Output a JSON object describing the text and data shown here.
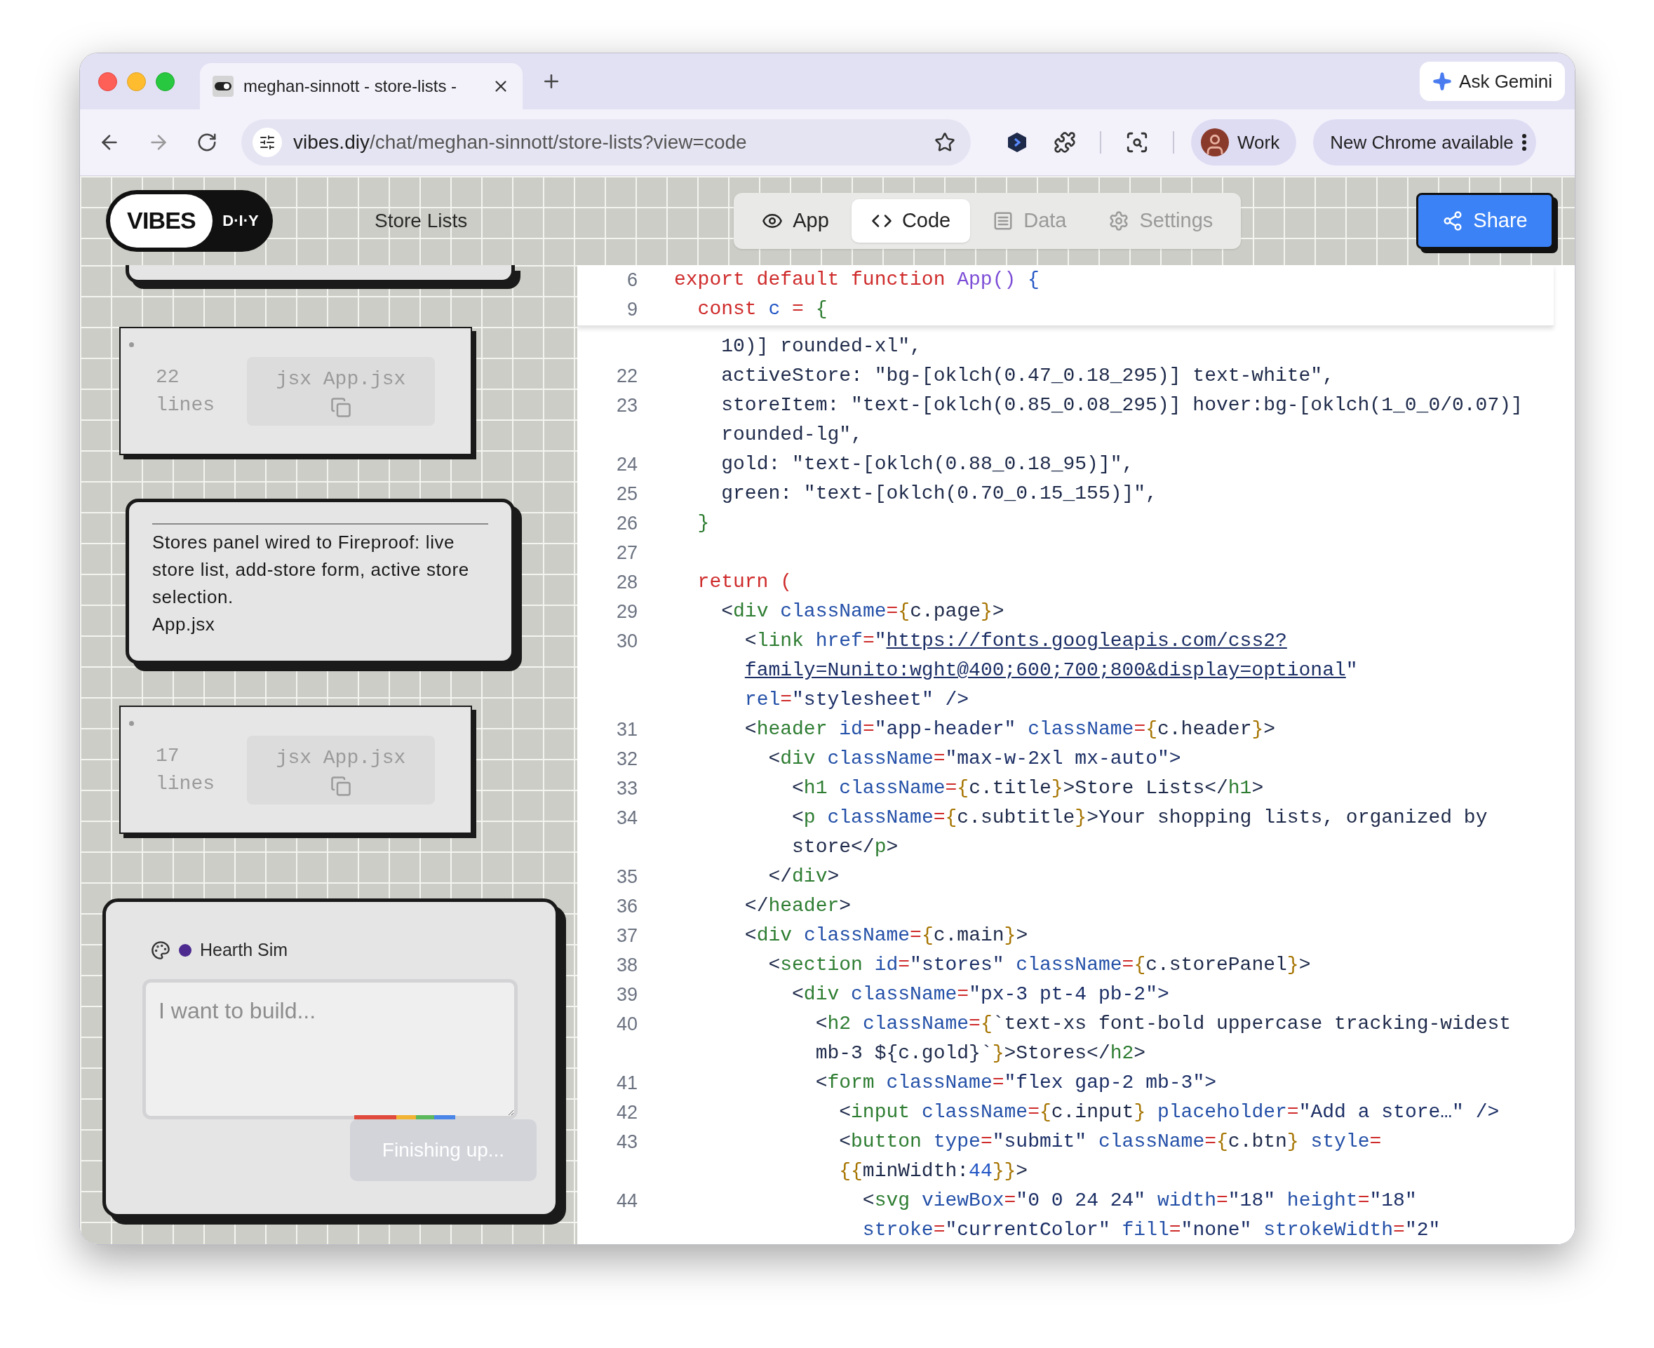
{
  "browser": {
    "tab": {
      "title": "meghan-sinnott - store-lists -"
    },
    "ask_gemini": "Ask Gemini",
    "url": {
      "host": "vibes.diy",
      "path": "/chat/meghan-sinnott/store-lists?view=code"
    },
    "profile": "Work",
    "update": "New Chrome available"
  },
  "app": {
    "logo": {
      "primary": "VIBES",
      "secondary": "D·I·Y"
    },
    "title": "Store Lists",
    "tabs": [
      {
        "label": "App",
        "selected": false,
        "disabled": false
      },
      {
        "label": "Code",
        "selected": true,
        "disabled": false
      },
      {
        "label": "Data",
        "selected": false,
        "disabled": true
      },
      {
        "label": "Settings",
        "selected": false,
        "disabled": true
      }
    ],
    "share": "Share"
  },
  "chat": {
    "messages": [
      {
        "kind": "partial"
      },
      {
        "kind": "code",
        "lines": "22 lines",
        "file": "jsx App.jsx"
      },
      {
        "kind": "text",
        "text": "Stores panel wired to Fireproof: live store list, add-store form, active store selection.",
        "file": "App.jsx"
      },
      {
        "kind": "code",
        "lines": "17 lines",
        "file": "jsx App.jsx"
      }
    ],
    "composer": {
      "model": "Hearth Sim",
      "color": "#4c2a8f",
      "placeholder": "I want to build...",
      "button": "Finishing up...",
      "disabled": true,
      "working": true
    }
  },
  "editor": {
    "sticky_lines": [
      {
        "number": "6",
        "tokens": [
          {
            "kind": "keyword",
            "text": "export default function "
          },
          {
            "kind": "function",
            "text": "App()"
          },
          {
            "kind": "punct",
            "text": " {"
          }
        ]
      },
      {
        "number": "9",
        "tokens": [
          {
            "kind": "keyword",
            "text": "  const "
          },
          {
            "kind": "punct",
            "text": "c "
          },
          {
            "kind": "operator",
            "text": "= "
          },
          {
            "kind": "tag",
            "text": "{"
          }
        ]
      }
    ],
    "lines": [
      {
        "tokens": [
          {
            "kind": "text",
            "text": "    10)] rounded-xl\","
          }
        ]
      },
      {
        "number": "22",
        "tokens": [
          {
            "kind": "text",
            "text": "    activeStore: \"bg-[oklch(0.47_0.18_295)] text-white\","
          }
        ]
      },
      {
        "number": "23",
        "tokens": [
          {
            "kind": "text",
            "text": "    storeItem: \"text-[oklch(0.85_0.08_295)] hover:bg-[oklch(1_0_0/0.07)]"
          }
        ]
      },
      {
        "tokens": [
          {
            "kind": "text",
            "text": "    rounded-lg\","
          }
        ]
      },
      {
        "number": "24",
        "tokens": [
          {
            "kind": "text",
            "text": "    gold: \"text-[oklch(0.88_0.18_95)]\","
          }
        ]
      },
      {
        "number": "25",
        "tokens": [
          {
            "kind": "text",
            "text": "    green: \"text-[oklch(0.70_0.15_155)]\","
          }
        ]
      },
      {
        "number": "26",
        "tokens": [
          {
            "kind": "tag",
            "text": "  }"
          }
        ]
      },
      {
        "number": "27"
      },
      {
        "number": "28",
        "tokens": [
          {
            "kind": "keyword",
            "text": "  return ("
          }
        ]
      },
      {
        "number": "29",
        "tokens": [
          {
            "kind": "text",
            "text": "    <"
          },
          {
            "kind": "tag",
            "text": "div"
          },
          {
            "kind": "attr",
            "text": " className"
          },
          {
            "kind": "operator",
            "text": "="
          },
          {
            "kind": "brace",
            "text": "{"
          },
          {
            "kind": "text",
            "text": "c.page"
          },
          {
            "kind": "brace",
            "text": "}"
          },
          {
            "kind": "text",
            "text": ">"
          }
        ]
      },
      {
        "number": "30",
        "tokens": [
          {
            "kind": "text",
            "text": "      <"
          },
          {
            "kind": "tag",
            "text": "link"
          },
          {
            "kind": "attr",
            "text": " href"
          },
          {
            "kind": "operator",
            "text": "="
          },
          {
            "kind": "string",
            "text": "\""
          },
          {
            "kind": "link",
            "text": "https://fonts.googleapis.com/css2?"
          }
        ]
      },
      {
        "tokens": [
          {
            "kind": "link",
            "text": "      family=Nunito:wght@400;600;700;800&display=optional"
          },
          {
            "kind": "string",
            "text": "\""
          }
        ]
      },
      {
        "tokens": [
          {
            "kind": "attr",
            "text": "      rel"
          },
          {
            "kind": "operator",
            "text": "="
          },
          {
            "kind": "string",
            "text": "\"stylesheet\" />"
          }
        ]
      },
      {
        "number": "31",
        "tokens": [
          {
            "kind": "text",
            "text": "      <"
          },
          {
            "kind": "tag",
            "text": "header"
          },
          {
            "kind": "attr",
            "text": " id"
          },
          {
            "kind": "operator",
            "text": "="
          },
          {
            "kind": "string",
            "text": "\"app-header\""
          },
          {
            "kind": "attr",
            "text": " className"
          },
          {
            "kind": "operator",
            "text": "="
          },
          {
            "kind": "brace",
            "text": "{"
          },
          {
            "kind": "text",
            "text": "c.header"
          },
          {
            "kind": "brace",
            "text": "}"
          },
          {
            "kind": "text",
            "text": ">"
          }
        ]
      },
      {
        "number": "32",
        "tokens": [
          {
            "kind": "text",
            "text": "        <"
          },
          {
            "kind": "tag",
            "text": "div"
          },
          {
            "kind": "attr",
            "text": " className"
          },
          {
            "kind": "operator",
            "text": "="
          },
          {
            "kind": "string",
            "text": "\"max-w-2xl mx-auto\">"
          }
        ]
      },
      {
        "number": "33",
        "tokens": [
          {
            "kind": "text",
            "text": "          <"
          },
          {
            "kind": "tag",
            "text": "h1"
          },
          {
            "kind": "attr",
            "text": " className"
          },
          {
            "kind": "operator",
            "text": "="
          },
          {
            "kind": "brace",
            "text": "{"
          },
          {
            "kind": "text",
            "text": "c.title"
          },
          {
            "kind": "brace",
            "text": "}"
          },
          {
            "kind": "text",
            "text": ">Store Lists</"
          },
          {
            "kind": "tag",
            "text": "h1"
          },
          {
            "kind": "text",
            "text": ">"
          }
        ]
      },
      {
        "number": "34",
        "tokens": [
          {
            "kind": "text",
            "text": "          <"
          },
          {
            "kind": "tag",
            "text": "p"
          },
          {
            "kind": "attr",
            "text": " className"
          },
          {
            "kind": "operator",
            "text": "="
          },
          {
            "kind": "brace",
            "text": "{"
          },
          {
            "kind": "text",
            "text": "c.subtitle"
          },
          {
            "kind": "brace",
            "text": "}"
          },
          {
            "kind": "text",
            "text": ">Your shopping lists, organized by"
          }
        ]
      },
      {
        "tokens": [
          {
            "kind": "text",
            "text": "          store</"
          },
          {
            "kind": "tag",
            "text": "p"
          },
          {
            "kind": "text",
            "text": ">"
          }
        ]
      },
      {
        "number": "35",
        "tokens": [
          {
            "kind": "text",
            "text": "        </"
          },
          {
            "kind": "tag",
            "text": "div"
          },
          {
            "kind": "text",
            "text": ">"
          }
        ]
      },
      {
        "number": "36",
        "tokens": [
          {
            "kind": "text",
            "text": "      </"
          },
          {
            "kind": "tag",
            "text": "header"
          },
          {
            "kind": "text",
            "text": ">"
          }
        ]
      },
      {
        "number": "37",
        "tokens": [
          {
            "kind": "text",
            "text": "      <"
          },
          {
            "kind": "tag",
            "text": "div"
          },
          {
            "kind": "attr",
            "text": " className"
          },
          {
            "kind": "operator",
            "text": "="
          },
          {
            "kind": "brace",
            "text": "{"
          },
          {
            "kind": "text",
            "text": "c.main"
          },
          {
            "kind": "brace",
            "text": "}"
          },
          {
            "kind": "text",
            "text": ">"
          }
        ]
      },
      {
        "number": "38",
        "tokens": [
          {
            "kind": "text",
            "text": "        <"
          },
          {
            "kind": "tag",
            "text": "section"
          },
          {
            "kind": "attr",
            "text": " id"
          },
          {
            "kind": "operator",
            "text": "="
          },
          {
            "kind": "string",
            "text": "\"stores\""
          },
          {
            "kind": "attr",
            "text": " className"
          },
          {
            "kind": "operator",
            "text": "="
          },
          {
            "kind": "brace",
            "text": "{"
          },
          {
            "kind": "text",
            "text": "c.storePanel"
          },
          {
            "kind": "brace",
            "text": "}"
          },
          {
            "kind": "text",
            "text": ">"
          }
        ]
      },
      {
        "number": "39",
        "tokens": [
          {
            "kind": "text",
            "text": "          <"
          },
          {
            "kind": "tag",
            "text": "div"
          },
          {
            "kind": "attr",
            "text": " className"
          },
          {
            "kind": "operator",
            "text": "="
          },
          {
            "kind": "string",
            "text": "\"px-3 pt-4 pb-2\">"
          }
        ]
      },
      {
        "number": "40",
        "tokens": [
          {
            "kind": "text",
            "text": "            <"
          },
          {
            "kind": "tag",
            "text": "h2"
          },
          {
            "kind": "attr",
            "text": " className"
          },
          {
            "kind": "operator",
            "text": "="
          },
          {
            "kind": "brace",
            "text": "{"
          },
          {
            "kind": "text",
            "text": "`text-xs font-bold uppercase tracking-widest"
          }
        ]
      },
      {
        "tokens": [
          {
            "kind": "text",
            "text": "            mb-3 ${c.gold}`"
          },
          {
            "kind": "brace",
            "text": "}"
          },
          {
            "kind": "text",
            "text": ">Stores</"
          },
          {
            "kind": "tag",
            "text": "h2"
          },
          {
            "kind": "text",
            "text": ">"
          }
        ]
      },
      {
        "number": "41",
        "tokens": [
          {
            "kind": "text",
            "text": "            <"
          },
          {
            "kind": "tag",
            "text": "form"
          },
          {
            "kind": "attr",
            "text": " className"
          },
          {
            "kind": "operator",
            "text": "="
          },
          {
            "kind": "string",
            "text": "\"flex gap-2 mb-3\">"
          }
        ]
      },
      {
        "number": "42",
        "tokens": [
          {
            "kind": "text",
            "text": "              <"
          },
          {
            "kind": "tag",
            "text": "input"
          },
          {
            "kind": "attr",
            "text": " className"
          },
          {
            "kind": "operator",
            "text": "="
          },
          {
            "kind": "brace",
            "text": "{"
          },
          {
            "kind": "text",
            "text": "c.input"
          },
          {
            "kind": "brace",
            "text": "}"
          },
          {
            "kind": "attr",
            "text": " placeholder"
          },
          {
            "kind": "operator",
            "text": "="
          },
          {
            "kind": "string",
            "text": "\"Add a store…\" />"
          }
        ]
      },
      {
        "number": "43",
        "tokens": [
          {
            "kind": "text",
            "text": "              <"
          },
          {
            "kind": "tag",
            "text": "button"
          },
          {
            "kind": "attr",
            "text": " type"
          },
          {
            "kind": "operator",
            "text": "="
          },
          {
            "kind": "string",
            "text": "\"submit\""
          },
          {
            "kind": "attr",
            "text": " className"
          },
          {
            "kind": "operator",
            "text": "="
          },
          {
            "kind": "brace",
            "text": "{"
          },
          {
            "kind": "text",
            "text": "c.btn"
          },
          {
            "kind": "brace",
            "text": "}"
          },
          {
            "kind": "attr",
            "text": " style"
          },
          {
            "kind": "operator",
            "text": "="
          }
        ]
      },
      {
        "tokens": [
          {
            "kind": "brace",
            "text": "              {{"
          },
          {
            "kind": "text",
            "text": "minWidth:"
          },
          {
            "kind": "punct",
            "text": "44"
          },
          {
            "kind": "brace",
            "text": "}}"
          },
          {
            "kind": "text",
            "text": ">"
          }
        ]
      },
      {
        "number": "44",
        "tokens": [
          {
            "kind": "text",
            "text": "                <"
          },
          {
            "kind": "tag",
            "text": "svg"
          },
          {
            "kind": "attr",
            "text": " viewBox"
          },
          {
            "kind": "operator",
            "text": "="
          },
          {
            "kind": "string",
            "text": "\"0 0 24 24\""
          },
          {
            "kind": "attr",
            "text": " width"
          },
          {
            "kind": "operator",
            "text": "="
          },
          {
            "kind": "string",
            "text": "\"18\""
          },
          {
            "kind": "attr",
            "text": " height"
          },
          {
            "kind": "operator",
            "text": "="
          },
          {
            "kind": "string",
            "text": "\"18\""
          }
        ]
      },
      {
        "tokens": [
          {
            "kind": "attr",
            "text": "                stroke"
          },
          {
            "kind": "operator",
            "text": "="
          },
          {
            "kind": "string",
            "text": "\"currentColor\""
          },
          {
            "kind": "attr",
            "text": " fill"
          },
          {
            "kind": "operator",
            "text": "="
          },
          {
            "kind": "string",
            "text": "\"none\""
          },
          {
            "kind": "attr",
            "text": " strokeWidth"
          },
          {
            "kind": "operator",
            "text": "="
          },
          {
            "kind": "string",
            "text": "\"2\""
          }
        ]
      }
    ]
  }
}
